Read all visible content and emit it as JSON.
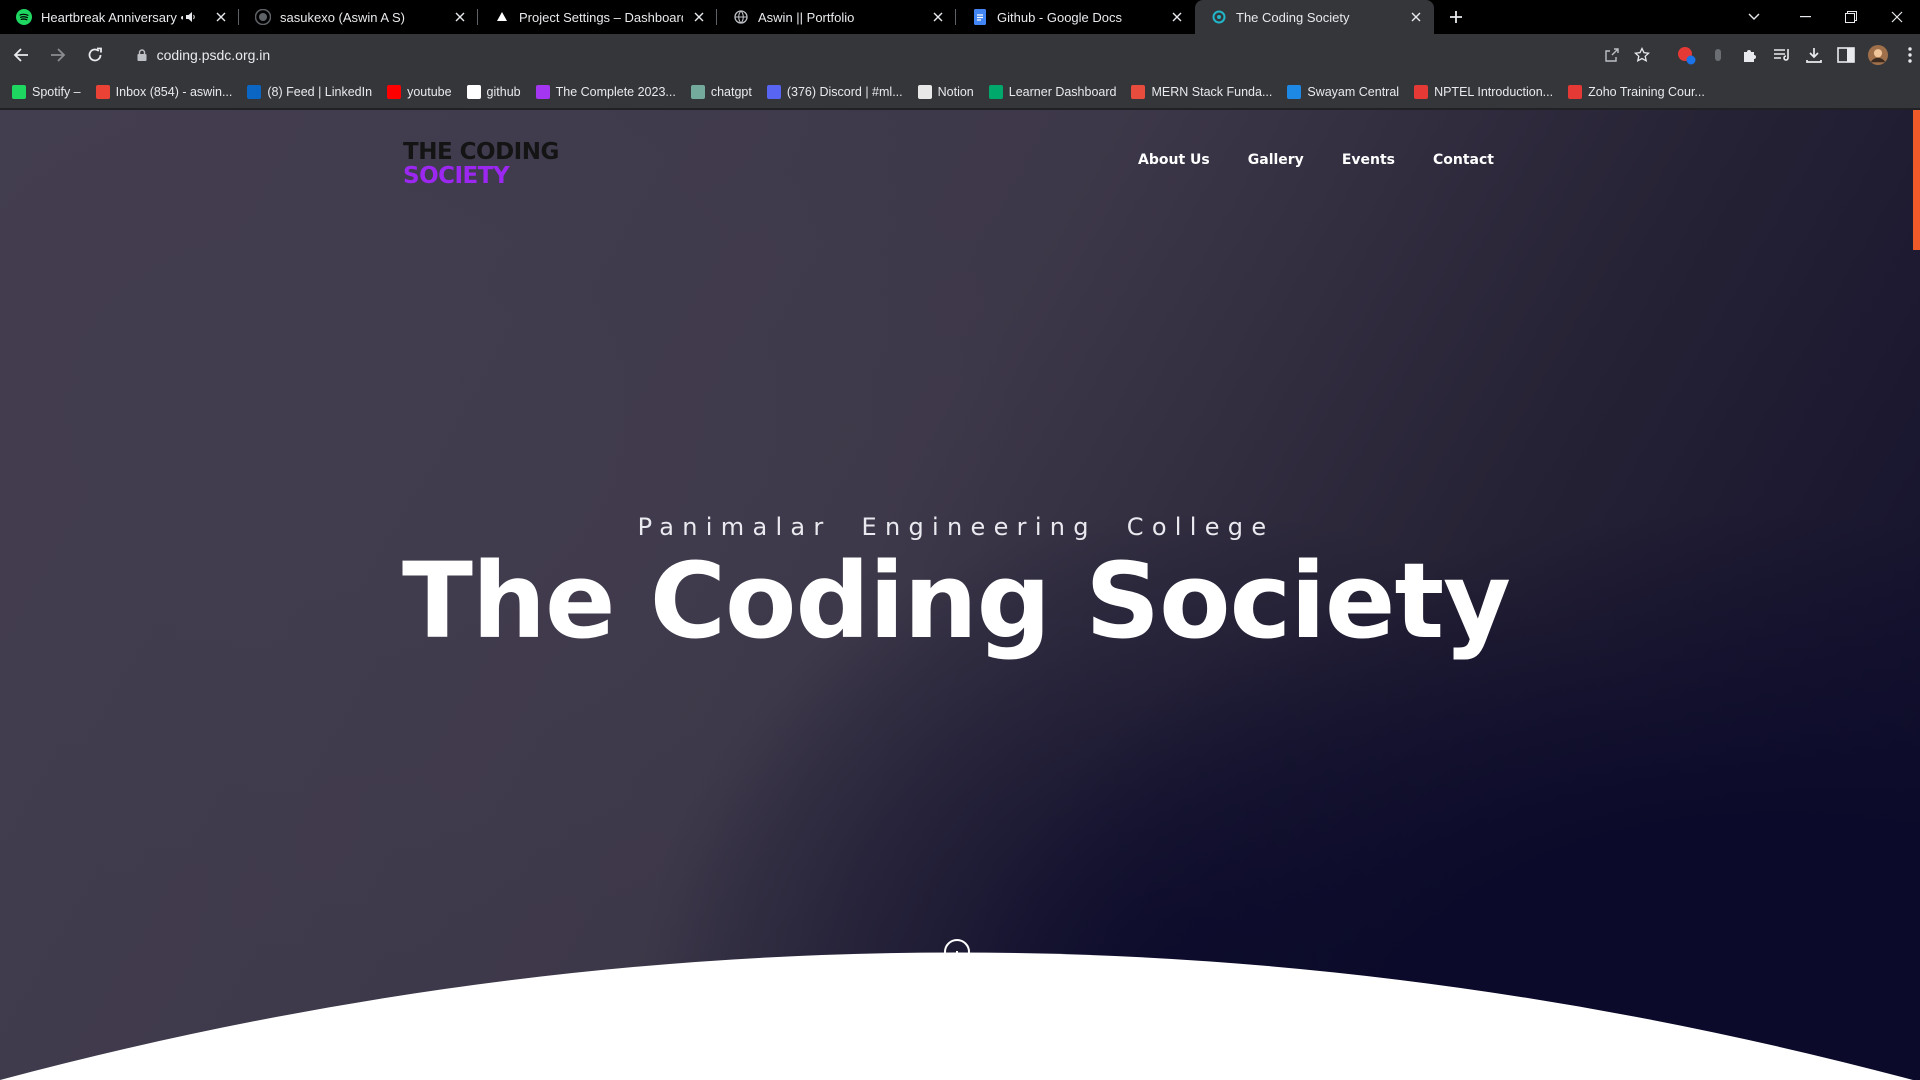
{
  "browser": {
    "tabs": [
      {
        "title": "Heartbreak Anniversary • Giv",
        "icon": "spotify-icon",
        "muted": true
      },
      {
        "title": "sasukexo (Aswin A S)",
        "icon": "github-icon"
      },
      {
        "title": "Project Settings – Dashboard – V",
        "icon": "vercel-icon"
      },
      {
        "title": "Aswin || Portfolio",
        "icon": "globe-icon"
      },
      {
        "title": "Github - Google Docs",
        "icon": "google-docs-icon"
      },
      {
        "title": "The Coding Society",
        "icon": "site-icon",
        "active": true
      }
    ],
    "url": "coding.psdc.org.in",
    "bookmarks": [
      {
        "label": "Spotify – ",
        "icon": "spotify-icon",
        "color": "#1ed760"
      },
      {
        "label": "Inbox (854) - aswin...",
        "icon": "gmail-icon",
        "color": "#ea4335"
      },
      {
        "label": "(8) Feed | LinkedIn",
        "icon": "linkedin-icon",
        "color": "#0a66c2"
      },
      {
        "label": "youtube",
        "icon": "youtube-icon",
        "color": "#ff0000"
      },
      {
        "label": "github",
        "icon": "github-icon",
        "color": "#ffffff"
      },
      {
        "label": "The Complete 2023...",
        "icon": "udemy-icon",
        "color": "#a435f0"
      },
      {
        "label": "chatgpt",
        "icon": "chatgpt-icon",
        "color": "#74aa9c"
      },
      {
        "label": "(376) Discord | #ml...",
        "icon": "discord-icon",
        "color": "#5865f2"
      },
      {
        "label": "Notion",
        "icon": "notion-icon",
        "color": "#e8e8e8"
      },
      {
        "label": "Learner Dashboard",
        "icon": "leaf-icon",
        "color": "#00a86b"
      },
      {
        "label": "MERN Stack Funda...",
        "icon": "mern-icon",
        "color": "#e74c3c"
      },
      {
        "label": "Swayam Central",
        "icon": "swayam-icon",
        "color": "#1e88e5"
      },
      {
        "label": "NPTEL Introduction...",
        "icon": "nptel-icon",
        "color": "#e53935"
      },
      {
        "label": "Zoho Training Cour...",
        "icon": "zoho-icon",
        "color": "#e53935"
      }
    ]
  },
  "site": {
    "logo_line1": "THE CODING",
    "logo_line2": "SOCIETY",
    "nav": [
      "About Us",
      "Gallery",
      "Events",
      "Contact"
    ],
    "subtitle": "Panimalar Engineering College",
    "headline": "The Coding Society",
    "colors": {
      "accent": "#9b27f1",
      "logo_dark": "#141414",
      "scroll_thumb": "#f05a28"
    }
  }
}
